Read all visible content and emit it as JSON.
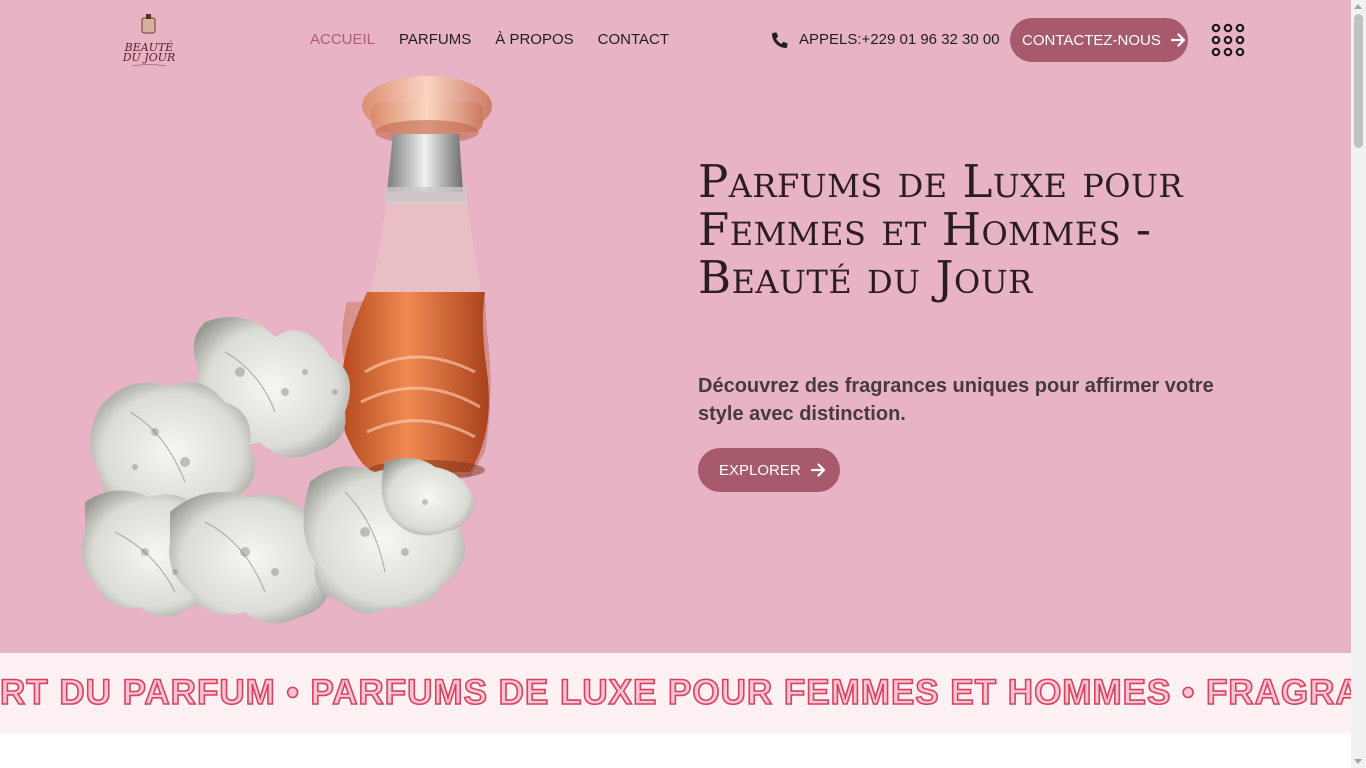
{
  "brand": {
    "logo_line1": "BEAUTÉ",
    "logo_line2": "DU JOUR"
  },
  "nav": {
    "items": [
      {
        "label": "ACCUEIL",
        "active": true
      },
      {
        "label": "PARFUMS",
        "active": false
      },
      {
        "label": "À PROPOS",
        "active": false
      },
      {
        "label": "CONTACT",
        "active": false
      }
    ]
  },
  "header": {
    "phone_text": "APPELS:+229 01 96 32 30 00",
    "phone_icon": "phone-icon",
    "contact_button": "CONTACTEZ-NOUS",
    "menu_icon": "grid-menu-icon"
  },
  "hero": {
    "title": "Parfums de Luxe pour Femmes et Hommes - Beauté du Jour",
    "subtitle": "Découvrez des fragrances uniques pour affirmer votre style avec distinction.",
    "button": "EXPLORER"
  },
  "marquee": {
    "text": "RT DU PARFUM • PARFUMS DE LUXE POUR FEMMES ET HOMMES • FRAGRANCES"
  },
  "colors": {
    "hero_bg": "#e8b4c5",
    "accent": "#a75a6c",
    "active_nav": "#b05c74",
    "marquee_bg": "#fdf1f3",
    "marquee_stroke": "#d8425e"
  }
}
